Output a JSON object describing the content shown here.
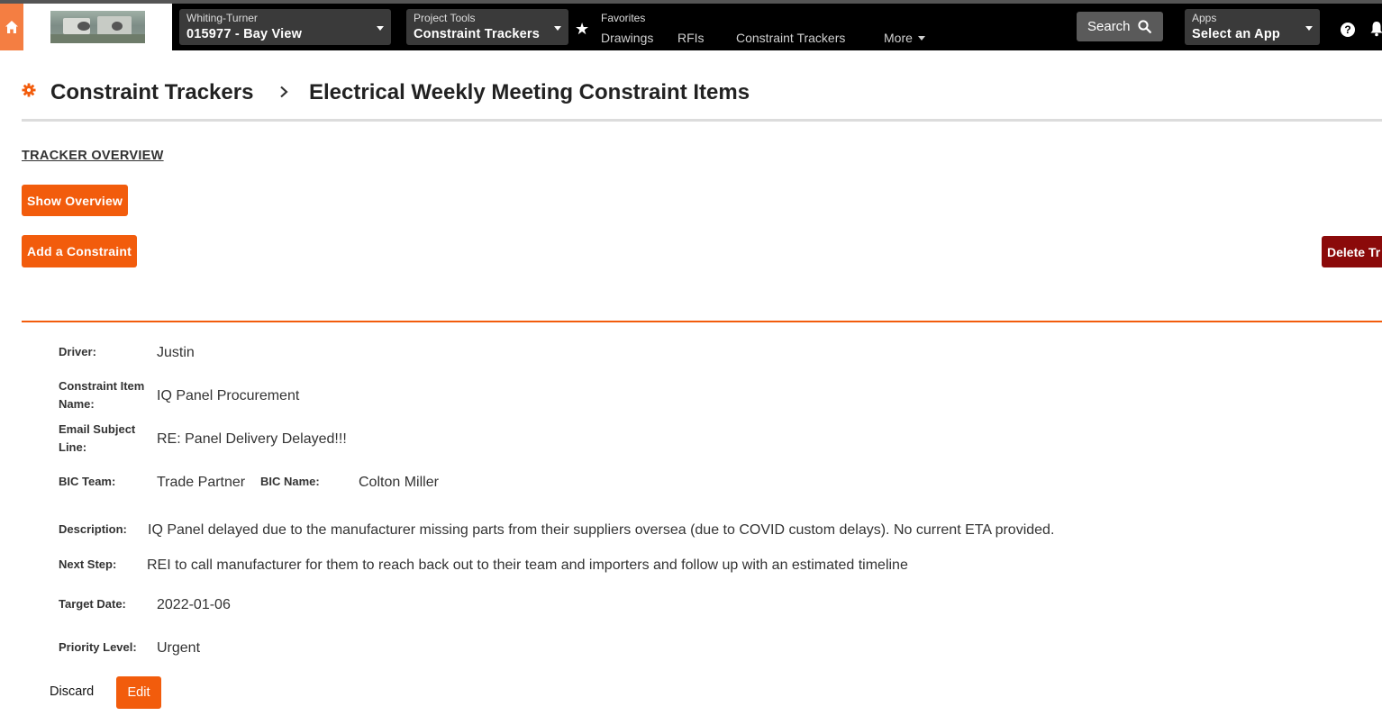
{
  "nav": {
    "company_label": "Whiting-Turner",
    "project_value": "015977 - Bay View",
    "tools_label": "Project Tools",
    "tools_value": "Constraint Trackers",
    "favorites_label": "Favorites",
    "favorites": [
      "Drawings",
      "RFIs",
      "Constraint Trackers"
    ],
    "more_label": "More",
    "search_label": "Search",
    "apps_label": "Apps",
    "apps_value": "Select an App",
    "help_glyph": "?"
  },
  "header": {
    "breadcrumb_root": "Constraint Trackers",
    "breadcrumb_current": "Electrical Weekly Meeting Constraint Items"
  },
  "actions": {
    "overview_link": "TRACKER OVERVIEW",
    "show_overview": "Show Overview",
    "add_constraint": "Add a Constraint",
    "delete_tracker": "Delete Tr"
  },
  "detail": {
    "driver_label": "Driver:",
    "driver": "Justin",
    "item_name_label_1": "Constraint Item",
    "item_name_label_2": "Name:",
    "item_name": "IQ Panel Procurement",
    "email_label_1": "Email Subject",
    "email_label_2": "Line:",
    "email_subject": "RE: Panel Delivery Delayed!!!",
    "bic_team_label": "BIC Team:",
    "bic_team": "Trade Partner",
    "bic_name_label": "BIC Name:",
    "bic_name": "Colton Miller",
    "description_label": "Description:",
    "description": "IQ Panel delayed due to the manufacturer missing parts from their suppliers oversea (due to COVID custom delays). No current ETA provided.",
    "next_step_label": "Next Step:",
    "next_step": "REI to call manufacturer for them to reach back out to their team and importers and follow up with an estimated timeline",
    "target_date_label": "Target Date:",
    "target_date": "2022-01-06",
    "priority_label": "Priority Level:",
    "priority": "Urgent"
  },
  "footer": {
    "discard": "Discard",
    "edit": "Edit"
  },
  "colors": {
    "accent": "#f25c0c",
    "home": "#f47e42",
    "danger": "#8b0a0a",
    "nav_bg": "#000000"
  }
}
